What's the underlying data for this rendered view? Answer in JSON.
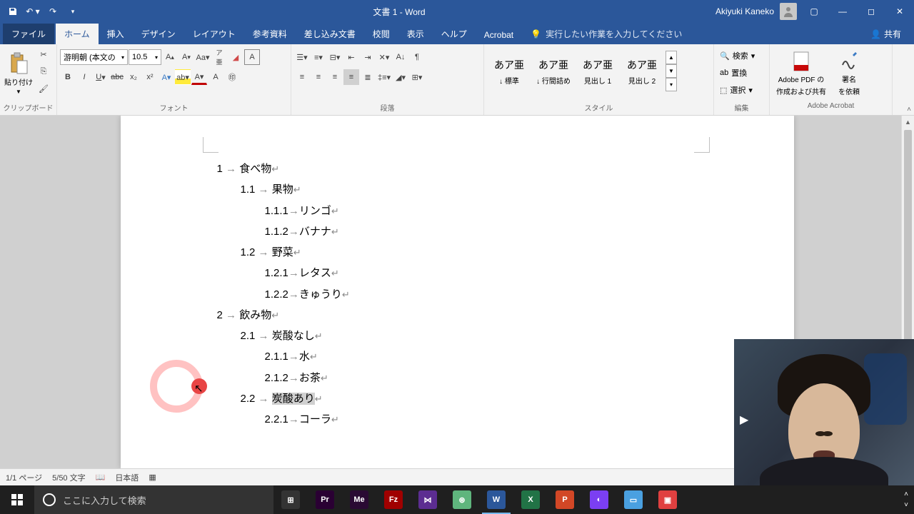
{
  "title": "文書 1 - Word",
  "user": "Akiyuki Kaneko",
  "qat": {
    "save": "save",
    "undo": "undo",
    "redo": "redo"
  },
  "tabs": {
    "file": "ファイル",
    "home": "ホーム",
    "insert": "挿入",
    "design": "デザイン",
    "layout": "レイアウト",
    "references": "参考資料",
    "mailings": "差し込み文書",
    "review": "校閲",
    "view": "表示",
    "help": "ヘルプ",
    "acrobat": "Acrobat"
  },
  "tellme": "実行したい作業を入力してください",
  "share": "共有",
  "groups": {
    "clipboard": {
      "label": "クリップボード",
      "paste": "貼り付け"
    },
    "font": {
      "label": "フォント",
      "name": "游明朝 (本文の",
      "size": "10.5"
    },
    "paragraph": {
      "label": "段落"
    },
    "styles": {
      "label": "スタイル",
      "items": [
        {
          "preview": "あア亜",
          "name": "↓ 標準"
        },
        {
          "preview": "あア亜",
          "name": "↓ 行間詰め"
        },
        {
          "preview": "あア亜",
          "name": "見出し 1"
        },
        {
          "preview": "あア亜",
          "name": "見出し 2"
        }
      ]
    },
    "editing": {
      "label": "編集",
      "find": "検索",
      "replace": "置換",
      "select": "選択"
    },
    "acrobat": {
      "label": "Adobe Acrobat",
      "pdf1": "Adobe PDF の",
      "pdf2": "作成および共有",
      "sig1": "署名",
      "sig2": "を依頼"
    }
  },
  "doc": {
    "lines": [
      {
        "lvl": 1,
        "num": "1",
        "sep": " → ",
        "text": "食べ物"
      },
      {
        "lvl": 2,
        "num": "1.1",
        "sep": " → ",
        "text": "果物"
      },
      {
        "lvl": 3,
        "num": "1.1.1",
        "sep": "→",
        "text": "リンゴ"
      },
      {
        "lvl": 3,
        "num": "1.1.2",
        "sep": "→",
        "text": "バナナ"
      },
      {
        "lvl": 2,
        "num": "1.2",
        "sep": " → ",
        "text": "野菜"
      },
      {
        "lvl": 3,
        "num": "1.2.1",
        "sep": "→",
        "text": "レタス"
      },
      {
        "lvl": 3,
        "num": "1.2.2",
        "sep": "→",
        "text": "きゅうり"
      },
      {
        "lvl": 1,
        "num": "2",
        "sep": " → ",
        "text": "飲み物"
      },
      {
        "lvl": 2,
        "num": "2.1",
        "sep": " → ",
        "text": "炭酸なし"
      },
      {
        "lvl": 3,
        "num": "2.1.1",
        "sep": "→",
        "text": "水"
      },
      {
        "lvl": 3,
        "num": "2.1.2",
        "sep": "→",
        "text": "お茶"
      },
      {
        "lvl": 2,
        "num": "2.2",
        "sep": " → ",
        "text": "炭酸あり",
        "selected": true
      },
      {
        "lvl": 3,
        "num": "2.2.1",
        "sep": "→",
        "text": "コーラ"
      }
    ]
  },
  "status": {
    "page": "1/1 ページ",
    "words": "5/50 文字",
    "lang": "日本語"
  },
  "taskbar": {
    "search_placeholder": "ここに入力して検索",
    "apps": [
      {
        "name": "task-view",
        "bg": "#333",
        "label": "⊞"
      },
      {
        "name": "premiere",
        "bg": "#2a0033",
        "label": "Pr"
      },
      {
        "name": "media-encoder",
        "bg": "#2a0a33",
        "label": "Me"
      },
      {
        "name": "filezilla",
        "bg": "#a00000",
        "label": "Fz"
      },
      {
        "name": "visual-studio",
        "bg": "#5c2d91",
        "label": "⋈"
      },
      {
        "name": "atom",
        "bg": "#5fb57d",
        "label": "⊛"
      },
      {
        "name": "word",
        "bg": "#2b579a",
        "label": "W",
        "active": true
      },
      {
        "name": "excel",
        "bg": "#217346",
        "label": "X"
      },
      {
        "name": "powerpoint",
        "bg": "#d24726",
        "label": "P"
      },
      {
        "name": "app-purple",
        "bg": "#7b3ff2",
        "label": "◐"
      },
      {
        "name": "notepad",
        "bg": "#4aa0e0",
        "label": "▭"
      },
      {
        "name": "camtasia",
        "bg": "#e04040",
        "label": "▣"
      }
    ]
  }
}
